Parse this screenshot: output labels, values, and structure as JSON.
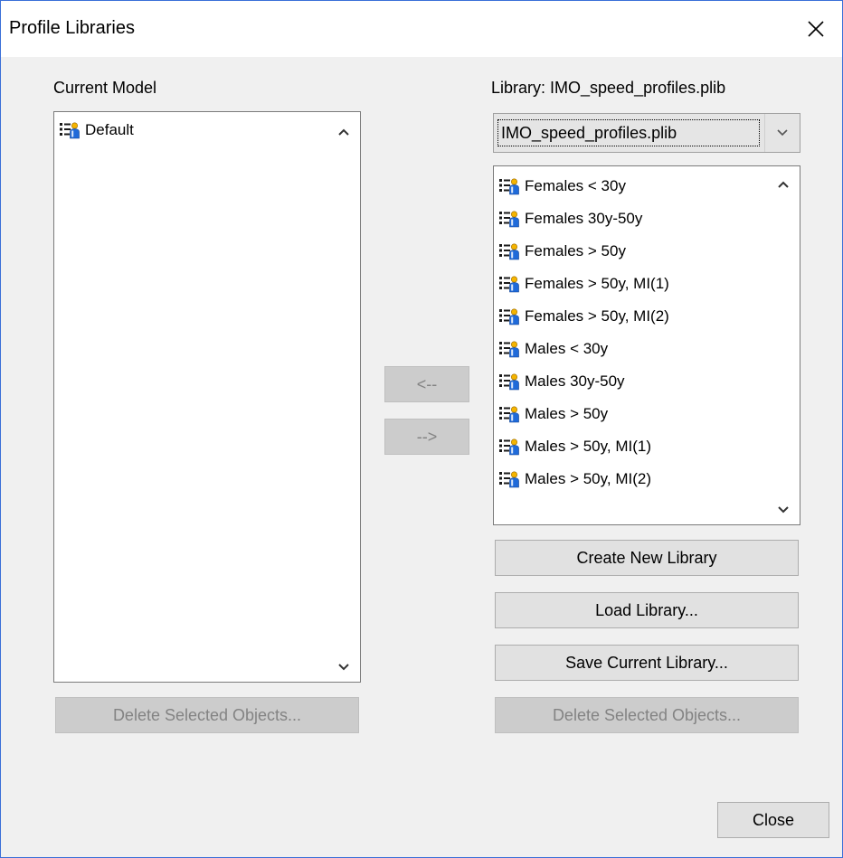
{
  "window": {
    "title": "Profile Libraries",
    "close_symbol": "✕"
  },
  "left": {
    "label": "Current Model",
    "items": [
      {
        "label": "Default",
        "icon": "profile-icon"
      }
    ],
    "delete_button": "Delete Selected Objects..."
  },
  "middle": {
    "move_left": "<--",
    "move_right": "-->"
  },
  "right": {
    "library_label": "Library: IMO_speed_profiles.plib",
    "library_select": "IMO_speed_profiles.plib",
    "items": [
      {
        "label": "Females < 30y",
        "icon": "profile-icon"
      },
      {
        "label": "Females 30y-50y",
        "icon": "profile-icon"
      },
      {
        "label": "Females > 50y",
        "icon": "profile-icon"
      },
      {
        "label": "Females > 50y, MI(1)",
        "icon": "profile-icon"
      },
      {
        "label": "Females > 50y, MI(2)",
        "icon": "profile-icon"
      },
      {
        "label": "Males < 30y",
        "icon": "profile-icon"
      },
      {
        "label": "Males 30y-50y",
        "icon": "profile-icon"
      },
      {
        "label": "Males > 50y",
        "icon": "profile-icon"
      },
      {
        "label": "Males > 50y, MI(1)",
        "icon": "profile-icon"
      },
      {
        "label": "Males > 50y, MI(2)",
        "icon": "profile-icon"
      }
    ],
    "create_button": "Create New Library",
    "load_button": "Load Library...",
    "save_button": "Save Current Library...",
    "delete_button": "Delete Selected Objects..."
  },
  "footer": {
    "close_button": "Close"
  },
  "colors": {
    "window_border": "#3a6fd8",
    "dialog_bg": "#f0f0f0",
    "button_bg": "#e1e1e1",
    "disabled_bg": "#cccccc",
    "disabled_text": "#838383"
  }
}
